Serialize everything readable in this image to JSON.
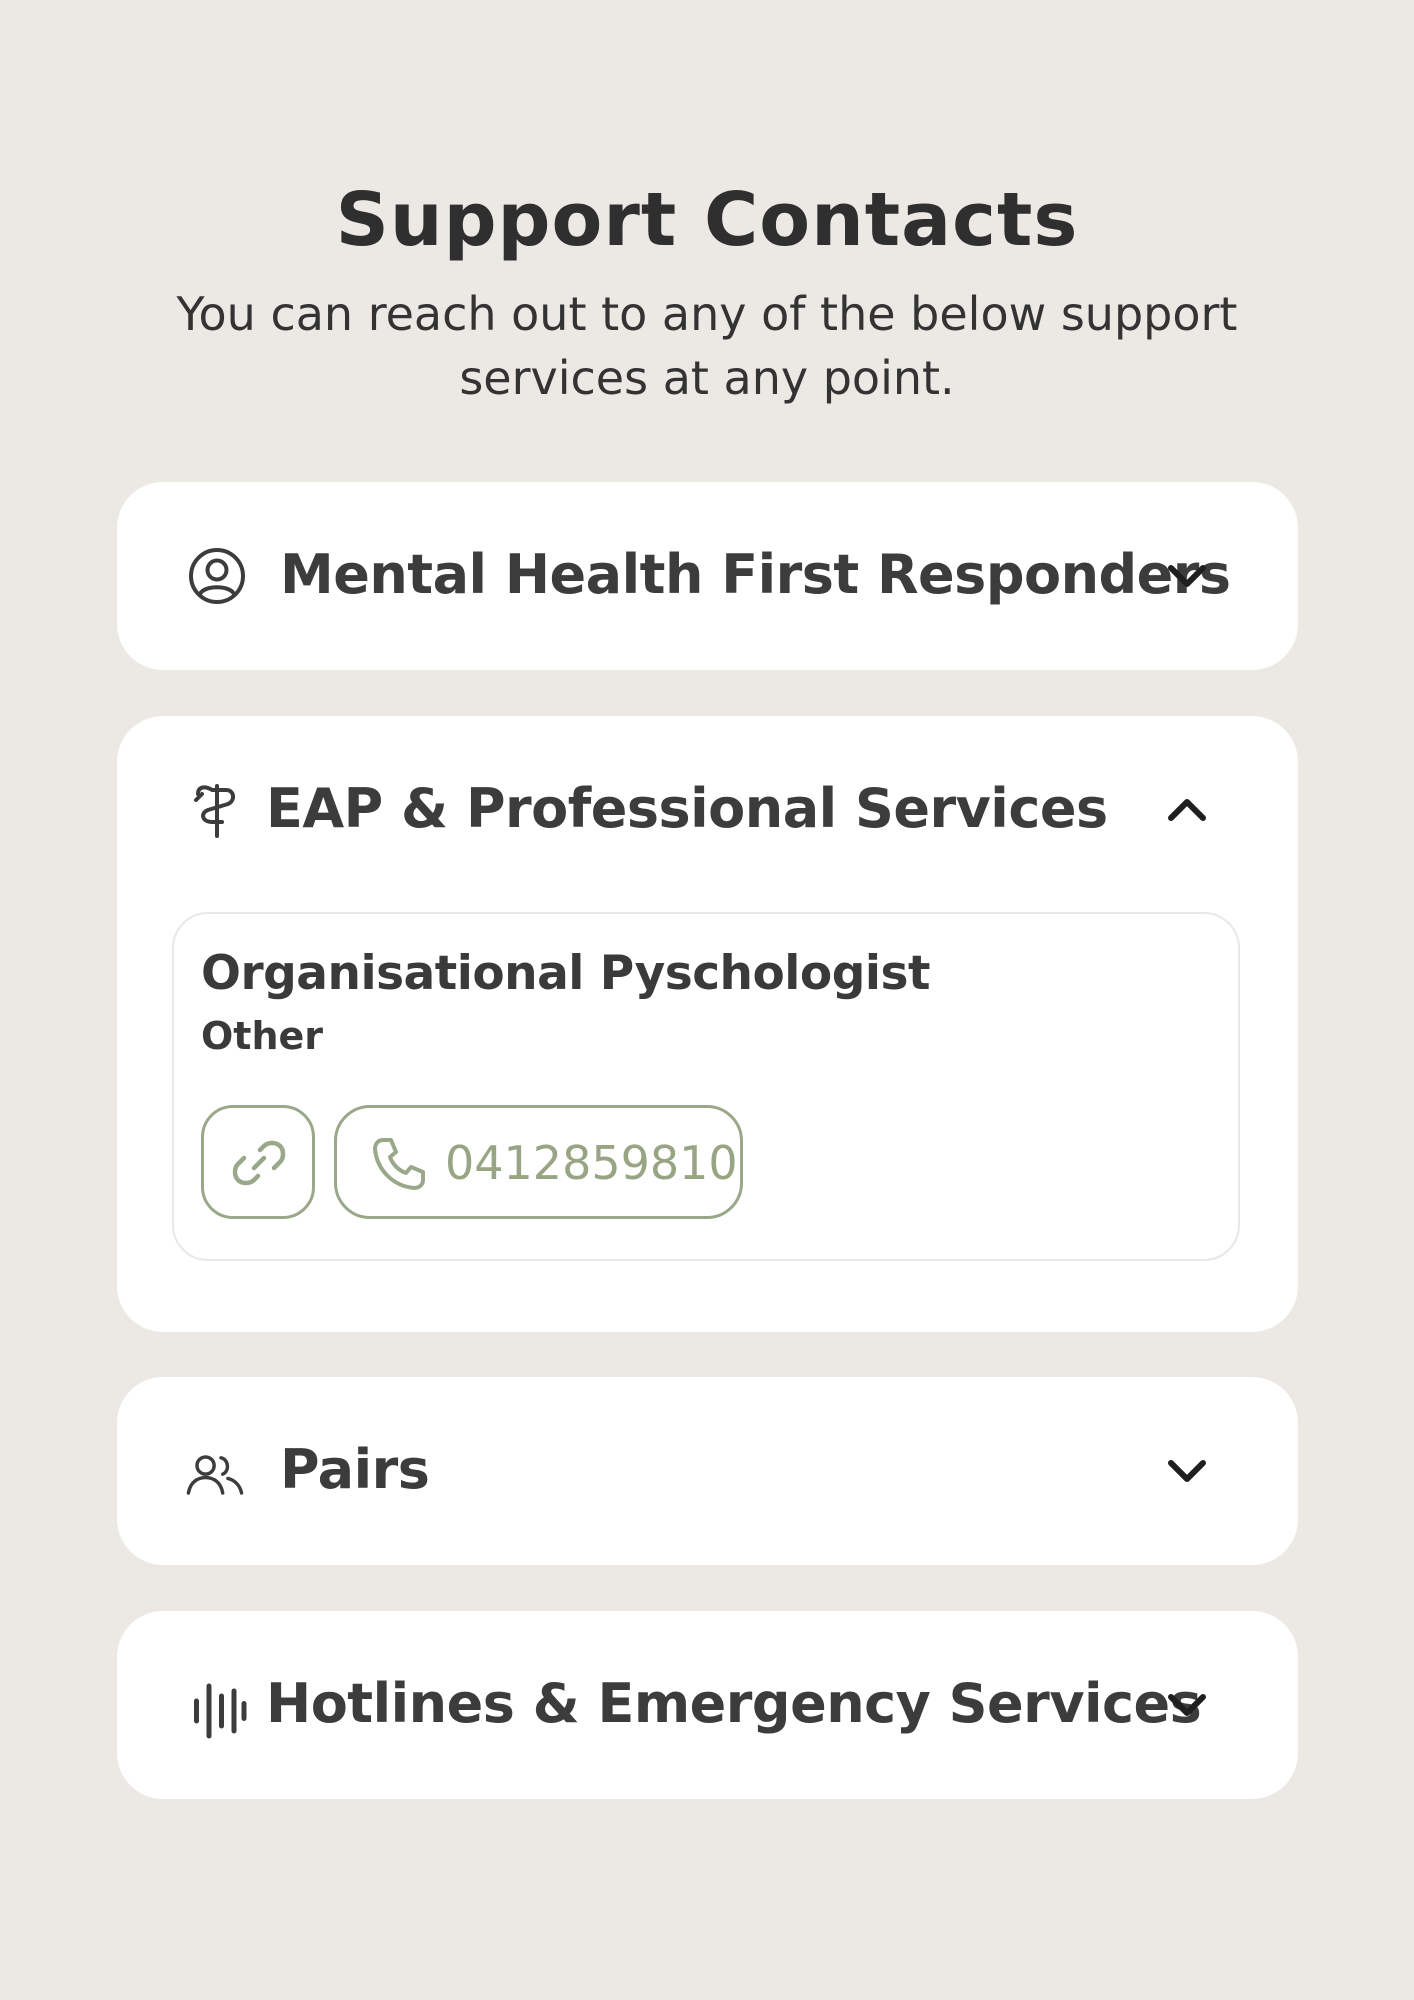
{
  "header": {
    "title": "Support Contacts",
    "subtitle": "You can reach out to any of the below support services at any point."
  },
  "sections": [
    {
      "title": "Mental Health First Responders",
      "icon": "user-circle-icon",
      "expanded": false
    },
    {
      "title": "EAP & Professional Services",
      "icon": "caduceus-icon",
      "expanded": true,
      "contacts": [
        {
          "name": "Organisational Pyschologist",
          "category": "Other",
          "link_icon": "link-icon",
          "phone": "0412859810"
        }
      ]
    },
    {
      "title": "Pairs",
      "icon": "users-icon",
      "expanded": false
    },
    {
      "title": "Hotlines & Emergency Services",
      "icon": "audio-wave-icon",
      "expanded": false
    }
  ],
  "colors": {
    "background": "#ECE9E5",
    "card": "#FFFFFF",
    "accent": "#9AA88A",
    "text": "#3A3A3A"
  }
}
